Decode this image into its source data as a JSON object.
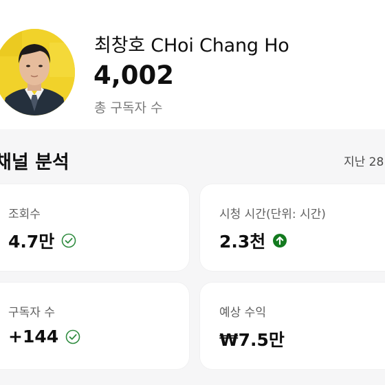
{
  "channel": {
    "name": "최창호 CHoi Chang Ho",
    "subscriber_count": "4,002",
    "subscriber_label": "총 구독자 수"
  },
  "analytics": {
    "title": "채널 분석",
    "period": "지난 28"
  },
  "cards": [
    {
      "label": "조회수",
      "value": "4.7만",
      "icon": "check-circle-icon"
    },
    {
      "label": "시청 시간(단위: 시간)",
      "value": "2.3천",
      "icon": "arrow-up-circle-icon"
    },
    {
      "label": "구독자 수",
      "value": "+144",
      "icon": "check-circle-icon"
    },
    {
      "label": "예상 수익",
      "value": "₩7.5만",
      "icon": null
    }
  ],
  "colors": {
    "check": "#2e8b3e",
    "up": "#137a1f",
    "avatar_bg": "#f1d22a"
  }
}
